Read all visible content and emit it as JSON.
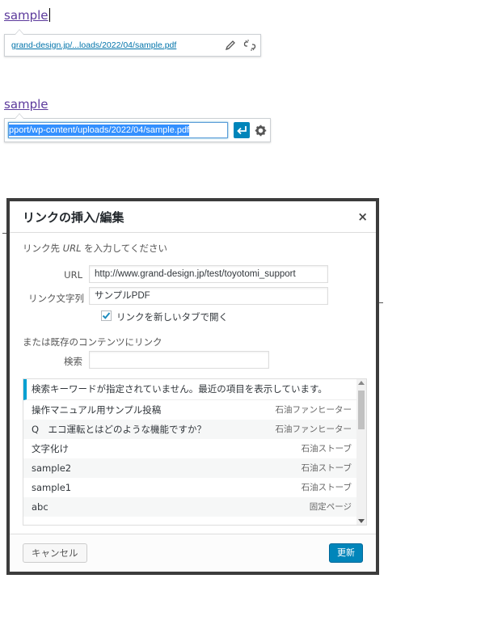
{
  "section1": {
    "link_text": "sample",
    "url_display": "grand-design.jp/...loads/2022/04/sample.pdf",
    "icons": [
      "pencil-icon",
      "unlink-icon"
    ]
  },
  "section2": {
    "link_text": "sample",
    "url_input_value": "pport/wp-content/uploads/2022/04/sample.pdf",
    "icons": [
      "enter-icon",
      "gear-icon"
    ]
  },
  "dialog": {
    "title": "リンクの挿入/編集",
    "close_symbol": "×",
    "instruction_prefix": "リンク先 ",
    "instruction_em": "URL",
    "instruction_suffix": " を入力してください",
    "url_label": "URL",
    "url_value": "http://www.grand-design.jp/test/toyotomi_support",
    "link_text_label": "リンク文字列",
    "link_text_value": "サンプルPDF",
    "new_tab_label": "リンクを新しいタブで開く",
    "new_tab_checked": true,
    "existing_label": "または既存のコンテンツにリンク",
    "search_label": "検索",
    "search_value": "",
    "results_notice": "検索キーワードが指定されていません。最近の項目を表示しています。",
    "results": [
      {
        "title": "操作マニュアル用サンプル投稿",
        "type": "石油ファンヒーター"
      },
      {
        "title": "Q　エコ運転とはどのような機能ですか？",
        "type": "石油ファンヒーター"
      },
      {
        "title": "文字化け",
        "type": "石油ストーブ"
      },
      {
        "title": "sample2",
        "type": "石油ストーブ"
      },
      {
        "title": "sample1",
        "type": "石油ストーブ"
      },
      {
        "title": "abc",
        "type": "固定ページ"
      }
    ],
    "cancel_label": "キャンセル",
    "update_label": "更新"
  },
  "colors": {
    "accent": "#0085ba",
    "link": "#0073aa",
    "visited_link": "#5c3a9c",
    "highlight": "#00a0d2"
  }
}
